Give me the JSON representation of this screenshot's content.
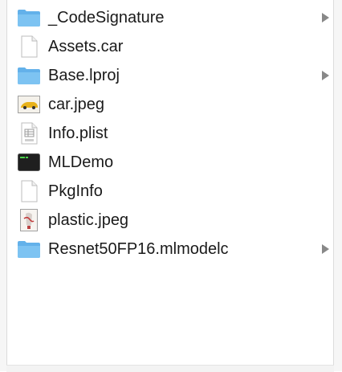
{
  "items": [
    {
      "name": "_CodeSignature",
      "kind": "folder",
      "has_children": true
    },
    {
      "name": "Assets.car",
      "kind": "document",
      "has_children": false
    },
    {
      "name": "Base.lproj",
      "kind": "folder",
      "has_children": true
    },
    {
      "name": "car.jpeg",
      "kind": "image-car",
      "has_children": false
    },
    {
      "name": "Info.plist",
      "kind": "plist",
      "has_children": false
    },
    {
      "name": "MLDemo",
      "kind": "executable",
      "has_children": false
    },
    {
      "name": "PkgInfo",
      "kind": "document",
      "has_children": false
    },
    {
      "name": "plastic.jpeg",
      "kind": "image-plastic",
      "has_children": false
    },
    {
      "name": "Resnet50FP16.mlmodelc",
      "kind": "folder",
      "has_children": true
    }
  ],
  "icons": {
    "folder": "folder-icon",
    "document": "document-icon",
    "image-car": "car-image-thumbnail-icon",
    "plist": "plist-file-icon",
    "executable": "terminal-executable-icon",
    "image-plastic": "plastic-image-thumbnail-icon",
    "chevron": "chevron-right-icon"
  },
  "colors": {
    "folder": "#6fb9ee",
    "chevron": "#888888",
    "text": "#1a1a1a"
  }
}
